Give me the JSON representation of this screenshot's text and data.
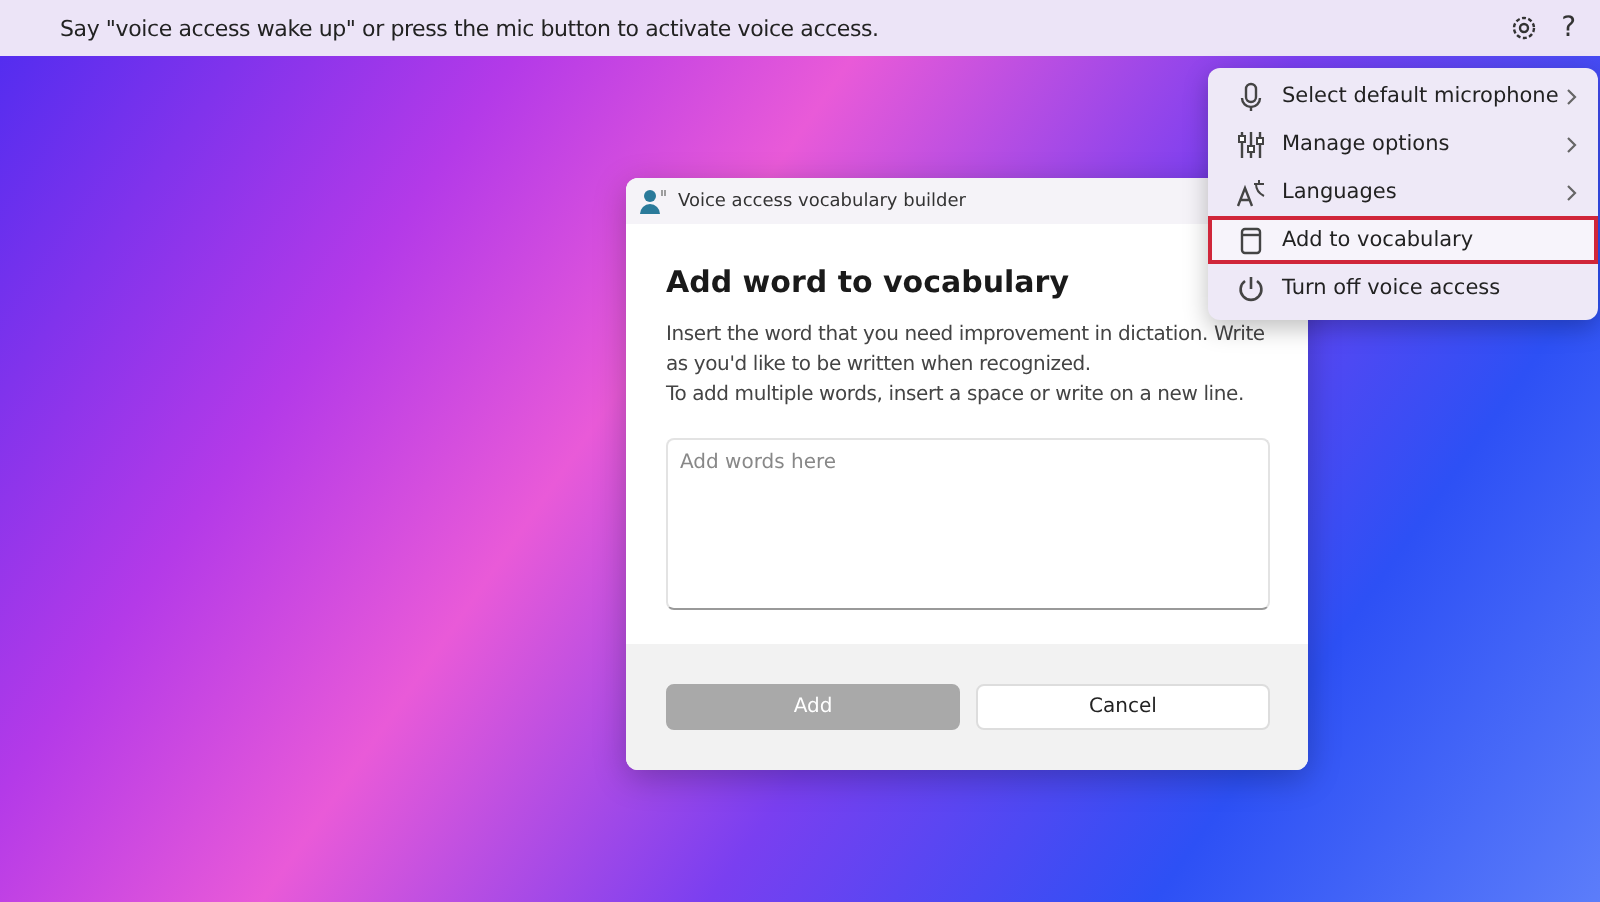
{
  "top_bar": {
    "message": "Say \"voice access wake up\" or press the mic button to activate voice access.",
    "help": "?"
  },
  "dialog": {
    "title": "Voice access vocabulary builder",
    "heading": "Add word to vocabulary",
    "description": [
      "Insert the word that you need improvement in dictation. Write as you'd like to be written when recognized.",
      "To add multiple words, insert a space or write on a new line."
    ],
    "input": {
      "placeholder": "Add words here"
    },
    "buttons": [
      {
        "label": "Add",
        "kind": "primary",
        "disabled": true
      },
      {
        "label": "Cancel",
        "kind": "secondary",
        "disabled": false
      }
    ]
  },
  "menu": {
    "items": [
      {
        "label": "Select default microphone",
        "kind": "mic",
        "submenu": true,
        "selected": false
      },
      {
        "label": "Manage options",
        "kind": "options",
        "submenu": true,
        "selected": false
      },
      {
        "label": "Languages",
        "kind": "language",
        "submenu": true,
        "selected": false
      },
      {
        "label": "Add to vocabulary",
        "kind": "book",
        "submenu": false,
        "selected": true
      },
      {
        "label": "Turn off voice access",
        "kind": "power",
        "submenu": false,
        "selected": false
      }
    ]
  }
}
